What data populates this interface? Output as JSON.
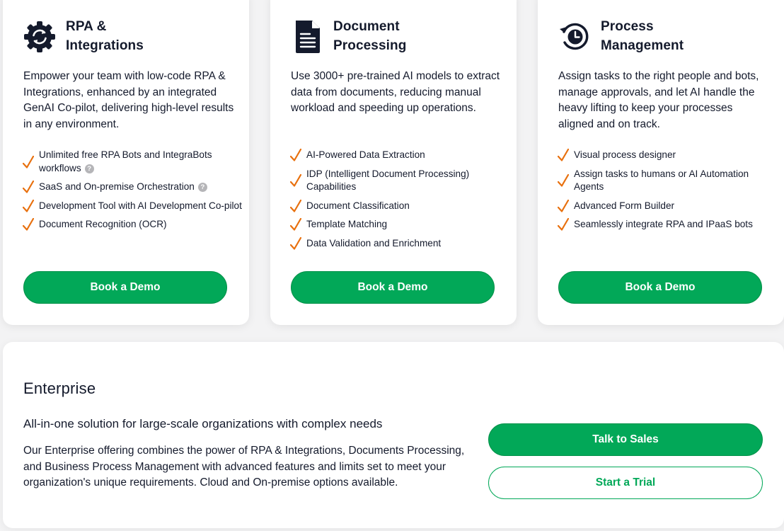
{
  "cards": [
    {
      "icon": "gear-sync-icon",
      "title_line1": "RPA &",
      "title_line2": "Integrations",
      "description": "Empower your team with low-code RPA & Integrations, enhanced by an integrated GenAI Co-pilot, delivering high-level results in any environment.",
      "features": [
        {
          "text": "Unlimited free RPA Bots and IntegraBots workflows",
          "help": "?"
        },
        {
          "text": "SaaS and On-premise Orchestration",
          "help": "?"
        },
        {
          "text": "Development Tool with AI Development Co-pilot"
        },
        {
          "text": "Document Recognition (OCR)"
        }
      ],
      "button": "Book a Demo"
    },
    {
      "icon": "document-icon",
      "title_line1": "Document",
      "title_line2": "Processing",
      "description": "Use 3000+ pre-trained AI models to extract data from documents, reducing manual workload and speeding up operations.",
      "features": [
        {
          "text": "AI-Powered Data Extraction"
        },
        {
          "text": "IDP (Intelligent Document Processing) Capabilities"
        },
        {
          "text": "Document Classification"
        },
        {
          "text": "Template Matching"
        },
        {
          "text": "Data Validation and Enrichment"
        }
      ],
      "button": "Book a Demo"
    },
    {
      "icon": "process-clock-icon",
      "title_line1": "Process",
      "title_line2": "Management",
      "description": "Assign tasks to the right people and bots, manage approvals, and let AI handle the heavy lifting to keep your processes aligned and on track.",
      "features": [
        {
          "text": "Visual process designer"
        },
        {
          "text": "Assign tasks to humans or AI Automation Agents"
        },
        {
          "text": "Advanced Form Builder"
        },
        {
          "text": "Seamlessly integrate RPA and IPaaS bots"
        }
      ],
      "button": "Book a Demo"
    }
  ],
  "enterprise": {
    "title": "Enterprise",
    "subtitle": "All-in-one solution for large-scale organizations with complex needs",
    "description": "Our Enterprise offering combines the power of RPA & Integrations, Documents Processing, and Business Process Management with advanced features and limits set to meet your organization's unique requirements. Cloud and On-premise options available.",
    "talk_button": "Talk to Sales",
    "trial_button": "Start a Trial"
  },
  "colors": {
    "accent_green": "#02a858",
    "check_orange": "#e8700e",
    "text_dark": "#141a2c"
  }
}
